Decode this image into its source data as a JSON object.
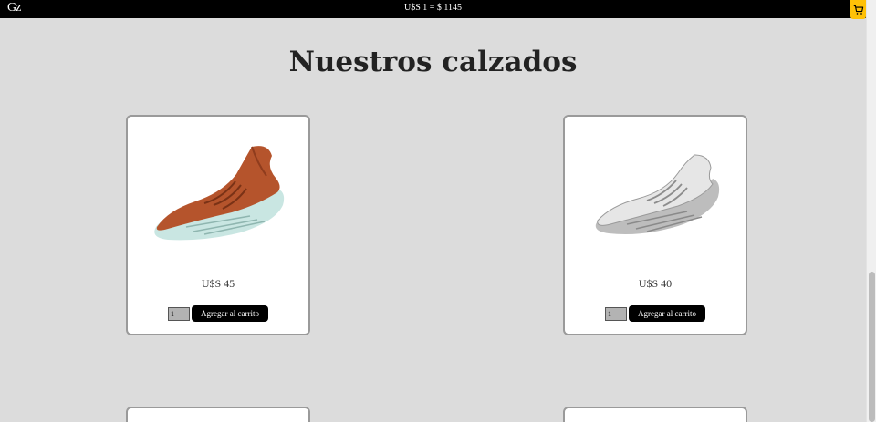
{
  "header": {
    "logo": "Gz",
    "exchange_rate": "U$S 1 = $ 1145",
    "cart_icon": "cart-icon",
    "accent": "#ffc107"
  },
  "main": {
    "title": "Nuestros calzados",
    "products": [
      {
        "price": "U$S 45",
        "qty": "1",
        "button": "Agregar al carrito",
        "image": "orange-sneaker"
      },
      {
        "price": "U$S 40",
        "qty": "1",
        "button": "Agregar al carrito",
        "image": "white-sneaker"
      }
    ]
  }
}
